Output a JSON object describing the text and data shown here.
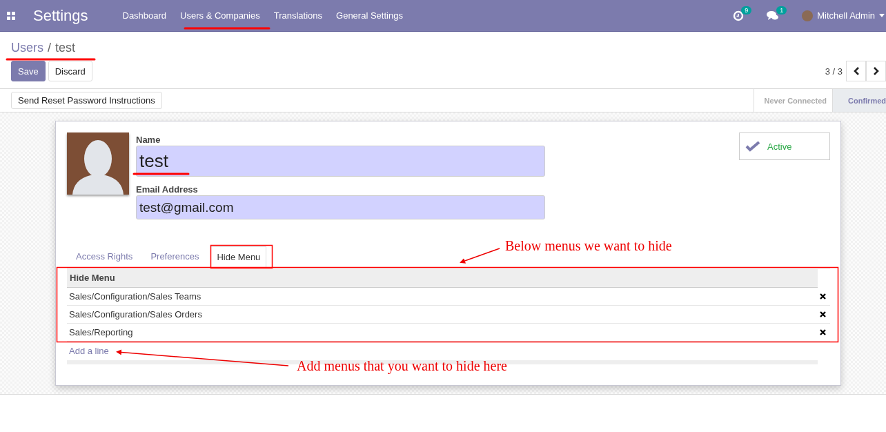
{
  "navbar": {
    "app_title": "Settings",
    "menu": [
      "Dashboard",
      "Users & Companies",
      "Translations",
      "General Settings"
    ],
    "activity_count": "9",
    "message_count": "1",
    "user": "Mitchell Admin"
  },
  "breadcrumb": {
    "parent": "Users",
    "separator": "/",
    "current": "test"
  },
  "buttons": [
    "Save",
    "Discard"
  ],
  "pager": "3 / 3",
  "action_button": "Send Reset Password Instructions",
  "stages": [
    {
      "label": "Never Connected",
      "selected": false
    },
    {
      "label": "Confirmed",
      "selected": true
    }
  ],
  "form": {
    "name_label": "Name",
    "name": "test",
    "email_label": "Email Address",
    "email": "test@gmail.com",
    "active": {
      "label": "Active",
      "on": true
    }
  },
  "tabs": [
    {
      "label": "Access Rights",
      "selected": false
    },
    {
      "label": "Preferences",
      "selected": false
    },
    {
      "label": "Hide Menu",
      "selected": true
    }
  ],
  "table": {
    "column": "Hide Menu",
    "rows": [
      {
        "menu": "Sales/Configuration/Sales Teams"
      },
      {
        "menu": "Sales/Configuration/Sales Orders"
      },
      {
        "menu": "Sales/Reporting"
      }
    ],
    "add_line": "Add a line"
  },
  "annotations": [
    {
      "text": "Below menus we want to hide"
    },
    {
      "text": "Add menus that you want to hide here"
    }
  ]
}
